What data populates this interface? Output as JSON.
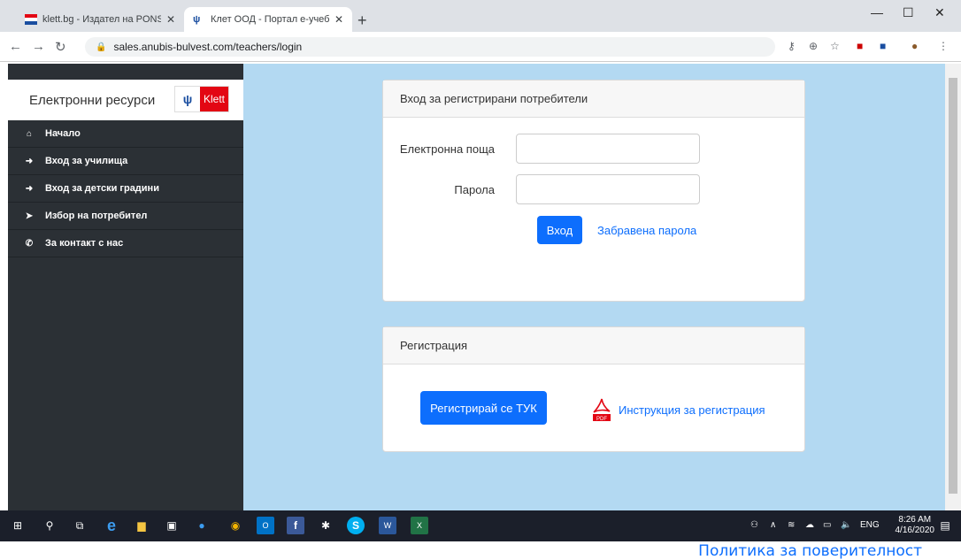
{
  "browser": {
    "tabs": [
      {
        "title": "klett.bg - Издател на PONS речн"
      },
      {
        "title": "Клет ООД - Портал е-учебници"
      }
    ],
    "url": "sales.anubis-bulvest.com/teachers/login"
  },
  "sidebar": {
    "brand": "Електронни ресурси",
    "logo_text": "Klett",
    "items": [
      {
        "label": "Начало",
        "icon": "home-icon"
      },
      {
        "label": "Вход за училища",
        "icon": "sign-in-icon"
      },
      {
        "label": "Вход за детски градини",
        "icon": "sign-in-icon"
      },
      {
        "label": "Избор на потребител",
        "icon": "user-choice-icon"
      },
      {
        "label": "За контакт с нас",
        "icon": "phone-icon"
      }
    ]
  },
  "login": {
    "title": "Вход за регистрирани потребители",
    "email_label": "Електронна поща",
    "email_value": "",
    "password_label": "Парола",
    "password_value": "",
    "submit_label": "Вход",
    "forgot_label": "Забравена парола"
  },
  "registration": {
    "title": "Регистрация",
    "register_label": "Регистрирай се ТУК",
    "instructions_label": "Инструкция за регистрация"
  },
  "footer": {
    "policy": "Политика за поверителност"
  },
  "taskbar": {
    "time": "8:26 AM",
    "date": "4/16/2020",
    "lang": "ENG"
  },
  "colors": {
    "accent": "#0d6efd",
    "sidebar": "#2b3035",
    "main_bg": "#b3d9f2",
    "klett_red": "#e30613"
  }
}
